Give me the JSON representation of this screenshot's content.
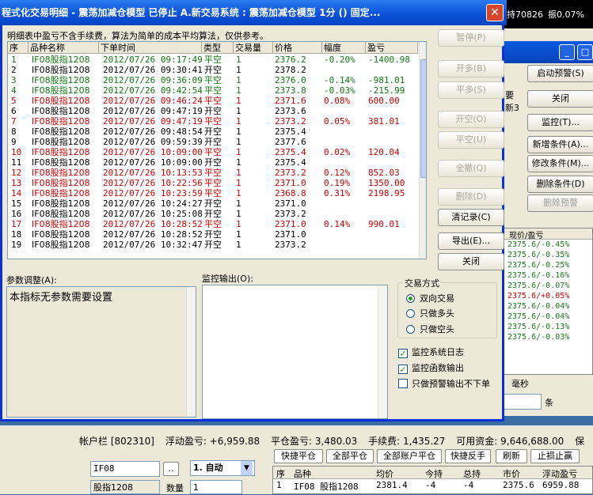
{
  "top_strip": {
    "items": [
      "持70826",
      "振0.07%"
    ]
  },
  "right_window": {
    "buttons": [
      {
        "label": "启动预警(S)",
        "disabled": false
      },
      {
        "label": "关闭",
        "disabled": false
      },
      {
        "label": "监控(T)...",
        "disabled": false
      },
      {
        "label": "新增条件(A)...",
        "disabled": false
      },
      {
        "label": "修改条件(M)...",
        "disabled": false
      },
      {
        "label": "删除条件(D)",
        "disabled": false
      },
      {
        "label": "删除预警",
        "disabled": true
      }
    ],
    "side_texts": [
      "要",
      "新3"
    ],
    "list_header": "现价/盈亏",
    "list_rows": [
      {
        "text": "2375.6/-0.45%",
        "color": "green"
      },
      {
        "text": "2375.6/-0.35%",
        "color": "green"
      },
      {
        "text": "2375.6/-0.25%",
        "color": "green"
      },
      {
        "text": "2375.6/-0.16%",
        "color": "green"
      },
      {
        "text": "2375.6/-0.07%",
        "color": "green"
      },
      {
        "text": "2375.6/+0.05%",
        "color": "red"
      },
      {
        "text": "2375.6/-0.04%",
        "color": "green"
      },
      {
        "text": "2375.6/-0.04%",
        "color": "green"
      },
      {
        "text": "2375.6/-0.13%",
        "color": "green"
      },
      {
        "text": "2375.6/-0.03%",
        "color": "green"
      }
    ],
    "misc_labels": {
      "ms": "毫秒",
      "tiao": "条"
    }
  },
  "dialog": {
    "title": "程式化交易明细 - 震荡加减仓模型 已停止  A.新交易系统 : 震荡加减仓模型 1分 () 固定...",
    "note": "明细表中盈亏不含手续费，算法为简单的成本平均算法，仅供参考。",
    "columns": [
      "序",
      "品种名称",
      "下单时间",
      "类型",
      "交易量",
      "价格",
      "幅度",
      "盈亏"
    ],
    "rows": [
      {
        "n": "1",
        "name": "IF08股指1208",
        "time": "2012/07/26 09:17:49",
        "type": "平空",
        "qty": "1",
        "price": "2376.2",
        "pct": "-0.20%",
        "pnl": "-1400.98",
        "color": "green"
      },
      {
        "n": "2",
        "name": "IF08股指1208",
        "time": "2012/07/26 09:30:41",
        "type": "开空",
        "qty": "1",
        "price": "2378.2",
        "pct": "",
        "pnl": "",
        "color": "black"
      },
      {
        "n": "3",
        "name": "IF08股指1208",
        "time": "2012/07/26 09:36:09",
        "type": "平空",
        "qty": "1",
        "price": "2376.0",
        "pct": "-0.14%",
        "pnl": "-981.01",
        "color": "green"
      },
      {
        "n": "4",
        "name": "IF08股指1208",
        "time": "2012/07/26 09:42:54",
        "type": "平空",
        "qty": "1",
        "price": "2373.8",
        "pct": "-0.03%",
        "pnl": "-215.99",
        "color": "green"
      },
      {
        "n": "5",
        "name": "IF08股指1208",
        "time": "2012/07/26 09:46:24",
        "type": "平空",
        "qty": "1",
        "price": "2371.6",
        "pct": "0.08%",
        "pnl": "600.00",
        "color": "red"
      },
      {
        "n": "6",
        "name": "IF08股指1208",
        "time": "2012/07/26 09:47:19",
        "type": "开空",
        "qty": "1",
        "price": "2373.6",
        "pct": "",
        "pnl": "",
        "color": "black"
      },
      {
        "n": "7",
        "name": "IF08股指1208",
        "time": "2012/07/26 09:47:19",
        "type": "平空",
        "qty": "1",
        "price": "2373.2",
        "pct": "0.05%",
        "pnl": "381.01",
        "color": "red"
      },
      {
        "n": "8",
        "name": "IF08股指1208",
        "time": "2012/07/26 09:48:54",
        "type": "开空",
        "qty": "1",
        "price": "2375.4",
        "pct": "",
        "pnl": "",
        "color": "black"
      },
      {
        "n": "9",
        "name": "IF08股指1208",
        "time": "2012/07/26 09:59:39",
        "type": "开空",
        "qty": "1",
        "price": "2377.6",
        "pct": "",
        "pnl": "",
        "color": "black"
      },
      {
        "n": "10",
        "name": "IF08股指1208",
        "time": "2012/07/26 10:09:00",
        "type": "平空",
        "qty": "1",
        "price": "2375.4",
        "pct": "0.02%",
        "pnl": "120.04",
        "color": "red"
      },
      {
        "n": "11",
        "name": "IF08股指1208",
        "time": "2012/07/26 10:09:00",
        "type": "开空",
        "qty": "1",
        "price": "2375.4",
        "pct": "",
        "pnl": "",
        "color": "black"
      },
      {
        "n": "12",
        "name": "IF08股指1208",
        "time": "2012/07/26 10:13:53",
        "type": "平空",
        "qty": "1",
        "price": "2373.2",
        "pct": "0.12%",
        "pnl": "852.03",
        "color": "red"
      },
      {
        "n": "13",
        "name": "IF08股指1208",
        "time": "2012/07/26 10:22:56",
        "type": "平空",
        "qty": "1",
        "price": "2371.0",
        "pct": "0.19%",
        "pnl": "1350.00",
        "color": "red"
      },
      {
        "n": "14",
        "name": "IF08股指1208",
        "time": "2012/07/26 10:23:59",
        "type": "平空",
        "qty": "1",
        "price": "2368.8",
        "pct": "0.31%",
        "pnl": "2198.95",
        "color": "red"
      },
      {
        "n": "15",
        "name": "IF08股指1208",
        "time": "2012/07/26 10:24:27",
        "type": "开空",
        "qty": "1",
        "price": "2371.0",
        "pct": "",
        "pnl": "",
        "color": "black"
      },
      {
        "n": "16",
        "name": "IF08股指1208",
        "time": "2012/07/26 10:25:08",
        "type": "开空",
        "qty": "1",
        "price": "2373.2",
        "pct": "",
        "pnl": "",
        "color": "black"
      },
      {
        "n": "17",
        "name": "IF08股指1208",
        "time": "2012/07/26 10:28:52",
        "type": "平空",
        "qty": "1",
        "price": "2371.0",
        "pct": "0.14%",
        "pnl": "990.01",
        "color": "red"
      },
      {
        "n": "18",
        "name": "IF08股指1208",
        "time": "2012/07/26 10:28:52",
        "type": "开空",
        "qty": "1",
        "price": "2371.0",
        "pct": "",
        "pnl": "",
        "color": "black"
      },
      {
        "n": "19",
        "name": "IF08股指1208",
        "time": "2012/07/26 10:32:47",
        "type": "开空",
        "qty": "1",
        "price": "2373.2",
        "pct": "",
        "pnl": "",
        "color": "black"
      }
    ],
    "side_buttons": [
      {
        "label": "暂停(P)",
        "disabled": true
      },
      {
        "label": "开多(B)",
        "disabled": true
      },
      {
        "label": "平多(S)",
        "disabled": true
      },
      {
        "label": "开空(O)",
        "disabled": true
      },
      {
        "label": "平空(U)",
        "disabled": true
      },
      {
        "label": "全撤(Q)",
        "disabled": true
      },
      {
        "label": "删除(D)",
        "disabled": true
      },
      {
        "label": "清记录(C)",
        "disabled": false
      },
      {
        "label": "导出(E)...",
        "disabled": false
      },
      {
        "label": "关闭",
        "disabled": false
      }
    ],
    "params_label": "参数调整(A):",
    "params_text": "本指标无参数需要设置",
    "monitor_label": "监控输出(O):",
    "trade_mode": {
      "title": "交易方式",
      "options": [
        "双向交易",
        "只做多头",
        "只做空头"
      ],
      "selected": 0
    },
    "checks": [
      {
        "label": "监控系统日志",
        "checked": true
      },
      {
        "label": "监控函数输出",
        "checked": true
      },
      {
        "label": "只做预警输出不下单",
        "checked": false
      }
    ]
  },
  "account_bar": {
    "account": "帐户栏 [802310]",
    "float_pnl": "浮动盈亏: +6,959.88",
    "close_pnl": "平仓盈亏: 3,480.03",
    "fee": "手续费: 1,435.27",
    "available": "可用资金: 9,646,688.00",
    "tail": "保",
    "buttons": [
      "快捷平仓",
      "全部平仓",
      "全部账户平仓",
      "快捷反手",
      "刷新",
      "止损止赢"
    ]
  },
  "order_panel": {
    "code": "IF08",
    "mode": "1. 自动",
    "name": "股指1208",
    "qty_label": "数量",
    "qty": "1"
  },
  "positions": {
    "columns": [
      "序",
      "品种",
      "均价",
      "今持",
      "总持",
      "市价",
      "浮动盈亏"
    ],
    "rows": [
      {
        "n": "1",
        "name": "IF08 股指1208",
        "avg": "2381.4",
        "today": "-4",
        "total": "-4",
        "market": "2375.6",
        "pnl": "6959.88"
      }
    ]
  }
}
